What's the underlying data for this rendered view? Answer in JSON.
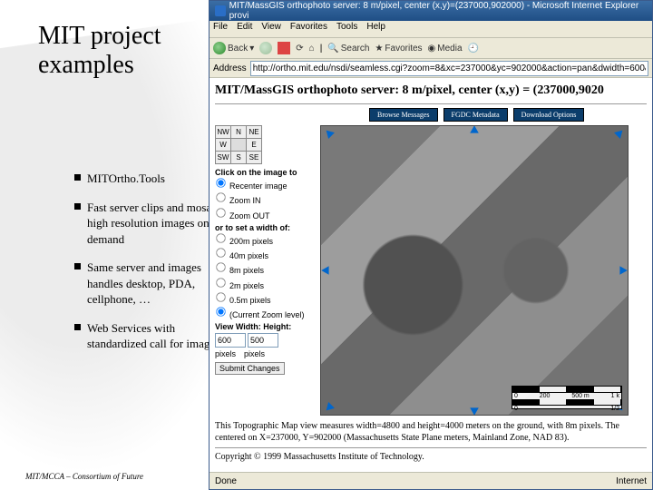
{
  "slide": {
    "title_l1": "MIT project",
    "title_l2": "examples",
    "bullets": [
      "MITOrtho.Tools",
      "Fast server clips and mosaics high resolution images on demand",
      "Same server and images handles desktop, PDA, cellphone, …",
      "Web Services with standardized call for imagery"
    ],
    "footer": "MIT/MCCA – Consortium of Future"
  },
  "browser": {
    "window_title": "MIT/MassGIS orthophoto server: 8 m/pixel, center (x,y)=(237000,902000) - Microsoft Internet Explorer provi",
    "menu": [
      "File",
      "Edit",
      "View",
      "Favorites",
      "Tools",
      "Help"
    ],
    "toolbar": {
      "back": "Back",
      "search": "Search",
      "favorites": "Favorites",
      "media": "Media"
    },
    "address_label": "Address",
    "url": "http://ortho.mit.edu/nsdi/seamless.cgi?zoom=8&xc=237000&yc=902000&action=pan&dwidth=600&height=500",
    "status_left": "Done",
    "status_right": "Internet"
  },
  "page": {
    "title": "MIT/MassGIS orthophoto server: 8 m/pixel, center (x,y) = (237000,9020",
    "header_buttons": [
      "Browse Messages",
      "FGDC Metadata",
      "Download Options"
    ],
    "compass": [
      "NW",
      "N",
      "NE",
      "W",
      "E",
      "SW",
      "S",
      "SE"
    ],
    "click_heading": "Click on the image to",
    "click_options": [
      "Recenter image",
      "Zoom IN",
      "Zoom OUT"
    ],
    "width_heading": "or to set a width of:",
    "zoom_options": [
      "200m pixels",
      "40m pixels",
      "8m pixels",
      "2m pixels",
      "0.5m pixels",
      "(Current Zoom level)"
    ],
    "view_heading": "View Width:  Height:",
    "view_width": "600",
    "view_height": "500",
    "view_units": [
      "pixels",
      "pixels"
    ],
    "submit_label": "Submit Changes",
    "scale": [
      "0",
      "200",
      "500 m",
      "1 k"
    ],
    "scale2": [
      "0",
      "1/2"
    ],
    "caption_l1": "This Topographic Map view measures width=4800 and height=4000 meters on the ground, with 8m pixels. The",
    "caption_l2": "centered on X=237000, Y=902000 (Massachusetts State Plane meters, Mainland Zone, NAD 83).",
    "copyright": "Copyright © 1999 Massachusetts Institute of Technology."
  }
}
